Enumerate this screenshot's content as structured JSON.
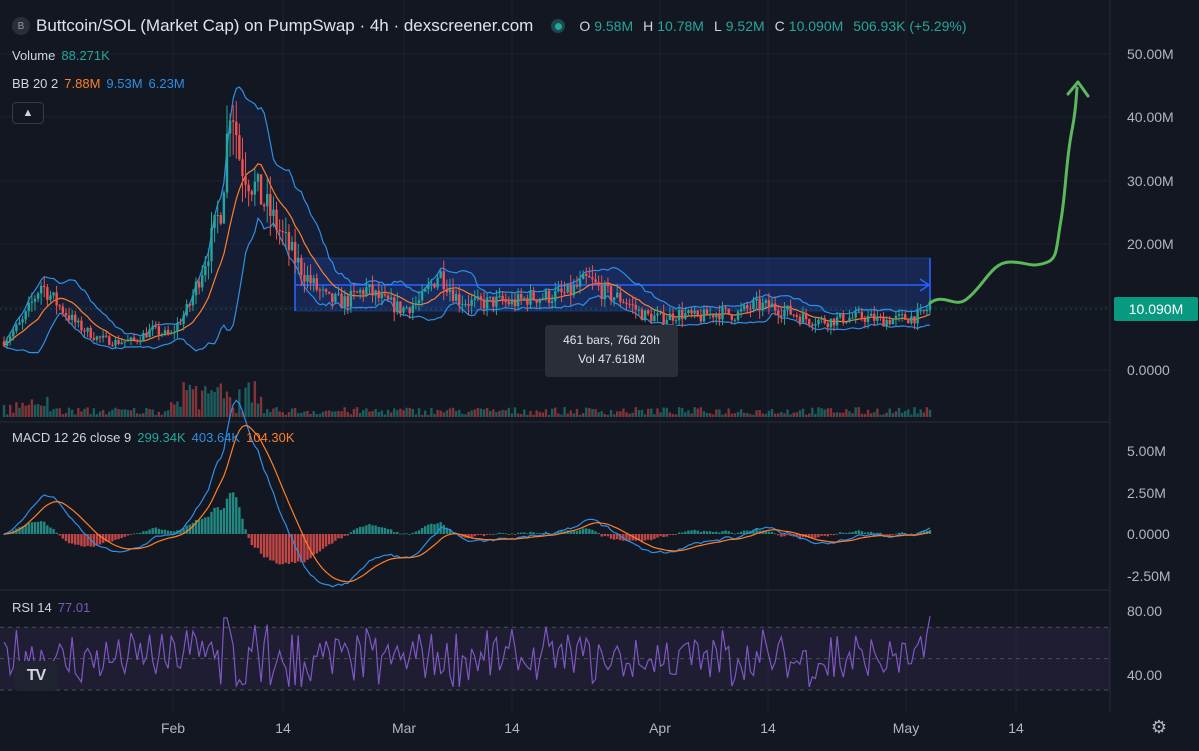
{
  "header": {
    "symbol_badge": "B",
    "title": "Buttcoin/SOL (Market Cap) on PumpSwap · 4h · dexscreener.com",
    "ohlc": [
      {
        "key": "O",
        "value": "9.58M"
      },
      {
        "key": "H",
        "value": "10.78M"
      },
      {
        "key": "L",
        "value": "9.52M"
      },
      {
        "key": "C",
        "value": "10.090M"
      }
    ],
    "change": "506.93K (+5.29%)"
  },
  "indicators": {
    "volume": {
      "label": "Volume",
      "value": "88.271K"
    },
    "bb": {
      "label": "BB 20 2",
      "basis": "7.88M",
      "upper": "9.53M",
      "lower": "6.23M"
    },
    "macd": {
      "label": "MACD 12 26 close 9",
      "hist": "299.34K",
      "macd": "403.64K",
      "signal": "104.30K"
    },
    "rsi": {
      "label": "RSI 14",
      "value": "77.01"
    }
  },
  "collapse_icon": "chevron-up-icon",
  "tooltip": {
    "line1": "461 bars, 76d 20h",
    "line2": "Vol 47.618M"
  },
  "price_tag": "10.090M",
  "main_axis_labels": [
    "50.00M",
    "40.00M",
    "30.00M",
    "20.00M",
    "10.00M",
    "0.0000"
  ],
  "macd_axis_labels": [
    "5.00M",
    "2.50M",
    "0.0000",
    "-2.50M"
  ],
  "rsi_axis_labels": [
    "80.00",
    "40.00"
  ],
  "time_labels": [
    "Feb",
    "14",
    "Mar",
    "14",
    "Apr",
    "14",
    "May",
    "14"
  ],
  "logo_text": "TV",
  "settings_icon": "gear-icon",
  "colors": {
    "background": "#131722",
    "up": "#26a69a",
    "down": "#ef5350",
    "bb_basis": "#ff7f27",
    "bb_band": "#2e8fe5",
    "rsi": "#7e57c2",
    "range_box": "#2962ff",
    "drawing": "#5cb85c"
  },
  "chart_data": {
    "type": "line",
    "main": {
      "y_unit": "market cap",
      "ylim": [
        0,
        55000000
      ],
      "close_path": [
        [
          0,
          4.5
        ],
        [
          0.02,
          7.6
        ],
        [
          0.04,
          13.5
        ],
        [
          0.06,
          10.0
        ],
        [
          0.08,
          7.0
        ],
        [
          0.1,
          5.1
        ],
        [
          0.12,
          4.4
        ],
        [
          0.14,
          4.6
        ],
        [
          0.16,
          6.3
        ],
        [
          0.18,
          5.4
        ],
        [
          0.2,
          10.0
        ],
        [
          0.22,
          18.5
        ],
        [
          0.235,
          26
        ],
        [
          0.245,
          44
        ],
        [
          0.255,
          33
        ],
        [
          0.27,
          29
        ],
        [
          0.29,
          24
        ],
        [
          0.31,
          18.5
        ],
        [
          0.33,
          14
        ],
        [
          0.35,
          11.0
        ],
        [
          0.37,
          10.8
        ],
        [
          0.39,
          12.8
        ],
        [
          0.41,
          10.8
        ],
        [
          0.43,
          9.6
        ],
        [
          0.45,
          10.8
        ],
        [
          0.47,
          15.4
        ],
        [
          0.49,
          11.2
        ],
        [
          0.51,
          10.4
        ],
        [
          0.53,
          10.8
        ],
        [
          0.55,
          10.6
        ],
        [
          0.57,
          11.5
        ],
        [
          0.59,
          11.6
        ],
        [
          0.61,
          12.1
        ],
        [
          0.63,
          14.2
        ],
        [
          0.65,
          12.1
        ],
        [
          0.67,
          11.0
        ],
        [
          0.69,
          8.7
        ],
        [
          0.71,
          8.1
        ],
        [
          0.73,
          8.9
        ],
        [
          0.75,
          8.2
        ],
        [
          0.77,
          9.1
        ],
        [
          0.79,
          8.7
        ],
        [
          0.81,
          10.1
        ],
        [
          0.83,
          10.0
        ],
        [
          0.85,
          9.0
        ],
        [
          0.87,
          7.9
        ],
        [
          0.89,
          7.7
        ],
        [
          0.91,
          8.2
        ],
        [
          0.93,
          8.3
        ],
        [
          0.95,
          7.8
        ],
        [
          0.97,
          8.1
        ],
        [
          0.99,
          8.5
        ],
        [
          1.0,
          10.09
        ]
      ],
      "last_close": "10.090M",
      "range_measure": {
        "bars": 461,
        "duration": "76d 20h",
        "volume": "47.618M"
      },
      "projection_drawing": "hand-drawn arrow pointing up to ~45M"
    },
    "rsi_levels": [
      70,
      50,
      30
    ],
    "rsi_last": 77.01
  }
}
